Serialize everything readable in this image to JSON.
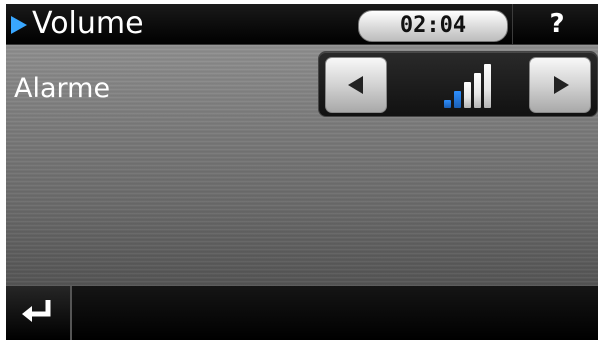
{
  "header": {
    "title": "Volume",
    "time": "02:04",
    "help_label": "?"
  },
  "settings": [
    {
      "label": "Alarme",
      "control": {
        "icon_left": "left-triangle-icon",
        "icon_right": "right-triangle-icon",
        "level": 2,
        "level_max": 5
      }
    }
  ],
  "footer": {
    "back_icon": "return-arrow-icon"
  },
  "colors": {
    "accent": "#39a7ff",
    "level_on": "#2d8fff",
    "level_off": "#e6e6e6"
  }
}
